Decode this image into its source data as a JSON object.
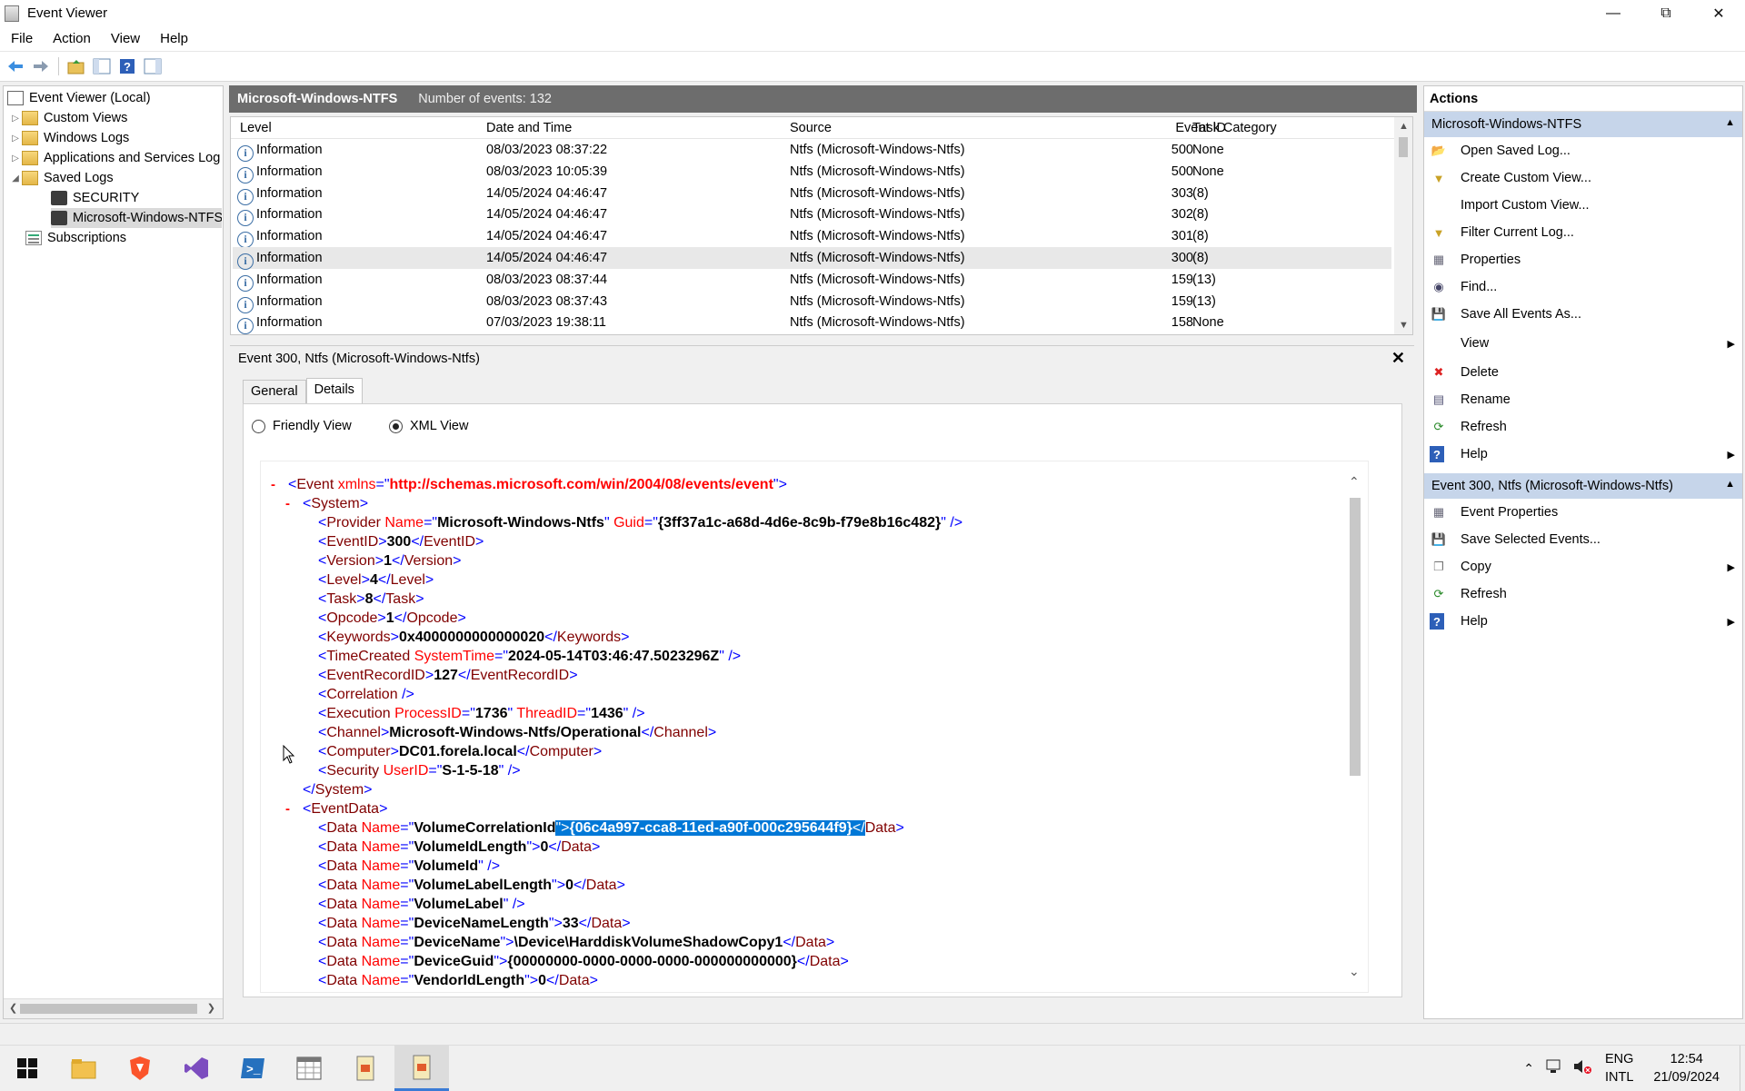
{
  "window": {
    "title": "Event Viewer"
  },
  "menu": [
    "File",
    "Action",
    "View",
    "Help"
  ],
  "tree": {
    "root": "Event Viewer (Local)",
    "items": [
      "Custom Views",
      "Windows Logs",
      "Applications and Services Log",
      "Saved Logs",
      "SECURITY",
      "Microsoft-Windows-NTFS",
      "Subscriptions"
    ]
  },
  "center": {
    "log_name": "Microsoft-Windows-NTFS",
    "event_count": "Number of events: 132",
    "columns": [
      "Level",
      "Date and Time",
      "Source",
      "Event ID",
      "Task Category"
    ],
    "rows": [
      {
        "level": "Information",
        "date": "08/03/2023 08:37:22",
        "source": "Ntfs (Microsoft-Windows-Ntfs)",
        "id": "500",
        "cat": "None"
      },
      {
        "level": "Information",
        "date": "08/03/2023 10:05:39",
        "source": "Ntfs (Microsoft-Windows-Ntfs)",
        "id": "500",
        "cat": "None"
      },
      {
        "level": "Information",
        "date": "14/05/2024 04:46:47",
        "source": "Ntfs (Microsoft-Windows-Ntfs)",
        "id": "303",
        "cat": "(8)"
      },
      {
        "level": "Information",
        "date": "14/05/2024 04:46:47",
        "source": "Ntfs (Microsoft-Windows-Ntfs)",
        "id": "302",
        "cat": "(8)"
      },
      {
        "level": "Information",
        "date": "14/05/2024 04:46:47",
        "source": "Ntfs (Microsoft-Windows-Ntfs)",
        "id": "301",
        "cat": "(8)"
      },
      {
        "level": "Information",
        "date": "14/05/2024 04:46:47",
        "source": "Ntfs (Microsoft-Windows-Ntfs)",
        "id": "300",
        "cat": "(8)"
      },
      {
        "level": "Information",
        "date": "08/03/2023 08:37:44",
        "source": "Ntfs (Microsoft-Windows-Ntfs)",
        "id": "159",
        "cat": "(13)"
      },
      {
        "level": "Information",
        "date": "08/03/2023 08:37:43",
        "source": "Ntfs (Microsoft-Windows-Ntfs)",
        "id": "159",
        "cat": "(13)"
      },
      {
        "level": "Information",
        "date": "07/03/2023 19:38:11",
        "source": "Ntfs (Microsoft-Windows-Ntfs)",
        "id": "158",
        "cat": "None"
      }
    ]
  },
  "details": {
    "title": "Event 300, Ntfs (Microsoft-Windows-Ntfs)",
    "tabs": [
      "General",
      "Details"
    ],
    "radio_friendly": "Friendly View",
    "radio_xml": "XML View",
    "xml": {
      "event_open_tag": "<Event xmlns=\"",
      "event_ns": "http://schemas.microsoft.com/win/2004/08/events/event",
      "event_open_tag_end": "\">",
      "system_open": "<System>",
      "provider_name": "Microsoft-Windows-Ntfs",
      "provider_guid": "{3ff37a1c-a68d-4d6e-8c9b-f79e8b16c482}",
      "event_id": "300",
      "version": "1",
      "level": "4",
      "task": "8",
      "opcode": "1",
      "keywords": "0x4000000000000020",
      "time_created": "2024-05-14T03:46:47.5023296Z",
      "record_id": "127",
      "process_id": "1736",
      "thread_id": "1436",
      "channel": "Microsoft-Windows-Ntfs/Operational",
      "computer": "DC01.forela.local",
      "user_id": "S-1-5-18",
      "volume_correlation_id": "{06c4a997-cca8-11ed-a90f-000c295644f9}",
      "volume_id_length": "0",
      "volume_label_length": "0",
      "device_name_length": "33",
      "device_name": "\\Device\\HarddiskVolumeShadowCopy1",
      "device_guid": "{00000000-0000-0000-0000-000000000000}",
      "vendor_id_length": "0"
    }
  },
  "actions": {
    "title": "Actions",
    "group1": "Microsoft-Windows-NTFS",
    "group1_items": [
      "Open Saved Log...",
      "Create Custom View...",
      "Import Custom View...",
      "Filter Current Log...",
      "Properties",
      "Find...",
      "Save All Events As...",
      "View",
      "Delete",
      "Rename",
      "Refresh",
      "Help"
    ],
    "group2": "Event 300, Ntfs (Microsoft-Windows-Ntfs)",
    "group2_items": [
      "Event Properties",
      "Save Selected Events...",
      "Copy",
      "Refresh",
      "Help"
    ]
  },
  "taskbar": {
    "lang1": "ENG",
    "lang2": "INTL",
    "time": "12:54",
    "date": "21/09/2024"
  }
}
